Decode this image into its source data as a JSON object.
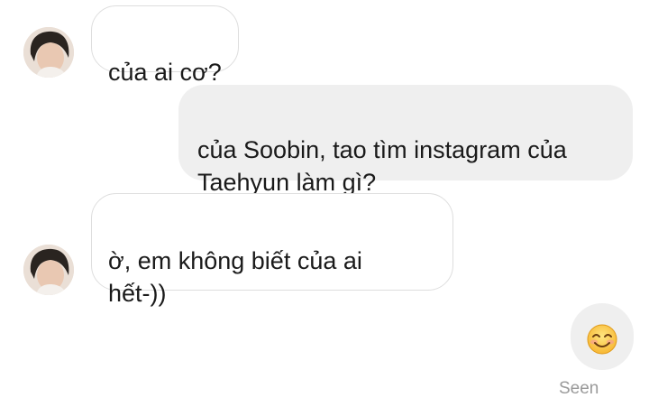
{
  "conversation": {
    "messages": [
      {
        "sender": "other",
        "text": "của ai cơ?"
      },
      {
        "sender": "me",
        "text": "của Soobin, tao tìm instagram của\nTaehyun làm gì?"
      },
      {
        "sender": "other",
        "text": "ờ, em không biết của ai\nhết-))"
      },
      {
        "sender": "me",
        "type": "emoji",
        "icon": "smiling-face-emoji"
      }
    ],
    "status": "Seen"
  },
  "colors": {
    "outgoing_bubble": "#efefef",
    "incoming_border": "#dedede",
    "seen_text": "#9a9a9a"
  }
}
